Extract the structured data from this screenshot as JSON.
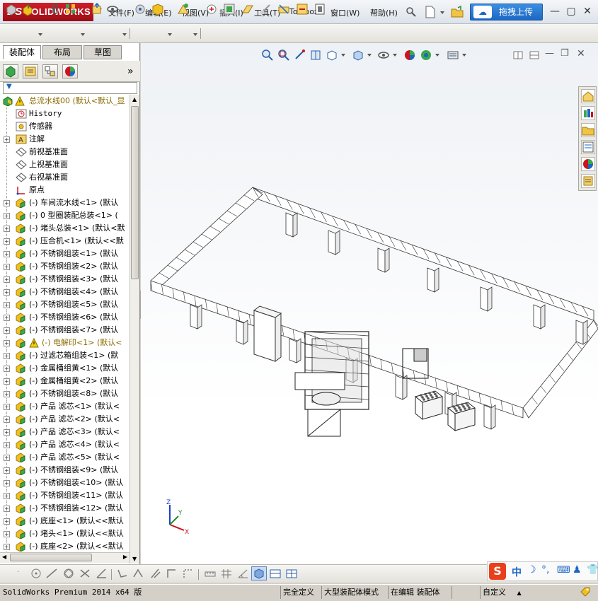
{
  "app": {
    "logo_prefix": "DS",
    "logo_text": "SOLIDWORKS"
  },
  "menu": [
    {
      "label": "文件(F)"
    },
    {
      "label": "编辑(E)"
    },
    {
      "label": "视图(V)"
    },
    {
      "label": "插入(I)"
    },
    {
      "label": "工具(T)"
    },
    {
      "label": "Toolbox"
    },
    {
      "label": "窗口(W)"
    },
    {
      "label": "帮助(H)"
    }
  ],
  "upload_button": {
    "label": "拖拽上传",
    "icon": "cloud-upload-icon"
  },
  "window_controls": {
    "minimize": "—",
    "restore": "▢",
    "close": "✕"
  },
  "panel_tabs": [
    {
      "label": "装配体"
    },
    {
      "label": "布局"
    },
    {
      "label": "草图"
    }
  ],
  "panel_more": "»",
  "filter_icon": "▼",
  "tree": {
    "root": {
      "label": "总流水线00  (默认<默认_显",
      "warning": true
    },
    "items": [
      {
        "label": "History",
        "icon": "history-icon",
        "mono": true,
        "expand": false
      },
      {
        "label": "传感器",
        "icon": "sensor-icon",
        "expand": false
      },
      {
        "label": "注解",
        "icon": "annotation-icon",
        "expand": true
      },
      {
        "label": "前视基准面",
        "icon": "plane-icon",
        "expand": false
      },
      {
        "label": "上视基准面",
        "icon": "plane-icon",
        "expand": false
      },
      {
        "label": "右视基准面",
        "icon": "plane-icon",
        "expand": false
      },
      {
        "label": "原点",
        "icon": "origin-icon",
        "expand": false
      },
      {
        "label": "(-) 车间流水线<1> (默认",
        "icon": "assembly-icon",
        "expand": true
      },
      {
        "label": "(-) 0 型圈装配总装<1> (",
        "icon": "assembly-icon",
        "expand": true
      },
      {
        "label": "(-) 堵头总装<1> (默认<默",
        "icon": "assembly-icon",
        "expand": true
      },
      {
        "label": "(-) 压合机<1> (默认<<默",
        "icon": "assembly-icon",
        "expand": true
      },
      {
        "label": "(-) 不锈钢组装<1> (默认",
        "icon": "assembly-icon",
        "expand": true
      },
      {
        "label": "(-) 不锈钢组装<2> (默认",
        "icon": "assembly-icon",
        "expand": true
      },
      {
        "label": "(-) 不锈钢组装<3> (默认",
        "icon": "assembly-icon",
        "expand": true
      },
      {
        "label": "(-) 不锈钢组装<4> (默认",
        "icon": "assembly-icon",
        "expand": true
      },
      {
        "label": "(-) 不锈钢组装<5> (默认",
        "icon": "assembly-icon",
        "expand": true
      },
      {
        "label": "(-) 不锈钢组装<6> (默认",
        "icon": "assembly-icon",
        "expand": true
      },
      {
        "label": "(-) 不锈钢组装<7> (默认",
        "icon": "assembly-icon",
        "expand": true
      },
      {
        "label": "(-) 电解印<1> (默认<",
        "icon": "assembly-icon",
        "expand": true,
        "warning": true
      },
      {
        "label": "(-) 过滤芯箱组装<1> (默",
        "icon": "assembly-icon",
        "expand": true
      },
      {
        "label": "(-) 金属桶组黄<1> (默认",
        "icon": "assembly-icon",
        "expand": true
      },
      {
        "label": "(-) 金属桶组黄<2> (默认",
        "icon": "assembly-icon",
        "expand": true
      },
      {
        "label": "(-) 不锈钢组装<8> (默认",
        "icon": "assembly-icon",
        "expand": true
      },
      {
        "label": "(-) 产品 滤芯<1> (默认<",
        "icon": "assembly-icon",
        "expand": true
      },
      {
        "label": "(-) 产品 滤芯<2> (默认<",
        "icon": "assembly-icon",
        "expand": true
      },
      {
        "label": "(-) 产品 滤芯<3> (默认<",
        "icon": "assembly-icon",
        "expand": true
      },
      {
        "label": "(-) 产品 滤芯<4> (默认<",
        "icon": "assembly-icon",
        "expand": true
      },
      {
        "label": "(-) 产品 滤芯<5> (默认<",
        "icon": "assembly-icon",
        "expand": true
      },
      {
        "label": "(-) 不锈钢组装<9> (默认",
        "icon": "assembly-icon",
        "expand": true
      },
      {
        "label": "(-) 不锈钢组装<10> (默认",
        "icon": "assembly-icon",
        "expand": true
      },
      {
        "label": "(-) 不锈钢组装<11> (默认",
        "icon": "assembly-icon",
        "expand": true
      },
      {
        "label": "(-) 不锈钢组装<12> (默认",
        "icon": "assembly-icon",
        "expand": true
      },
      {
        "label": "(-) 底座<1> (默认<<默认",
        "icon": "assembly-icon",
        "expand": true
      },
      {
        "label": "(-) 堵头<1> (默认<<默认",
        "icon": "assembly-icon",
        "expand": true
      },
      {
        "label": "(-) 底座<2> (默认<<默认",
        "icon": "assembly-icon",
        "expand": true
      }
    ]
  },
  "triad": {
    "x": "X",
    "y": "Y",
    "z": "Z"
  },
  "ime": {
    "brand": "S",
    "lang": "中"
  },
  "status": {
    "version": "SolidWorks Premium 2014 x64 版",
    "defined": "完全定义",
    "mode": "大型装配体模式",
    "editing": "在编辑 装配体",
    "custom": "自定义",
    "custom_arrow": "▲"
  },
  "colors": {
    "accent": "#1b67c2",
    "brand": "#c8161f",
    "warning": "#e0b000",
    "part_green": "#3aa84b",
    "part_yellow": "#f0c020"
  }
}
